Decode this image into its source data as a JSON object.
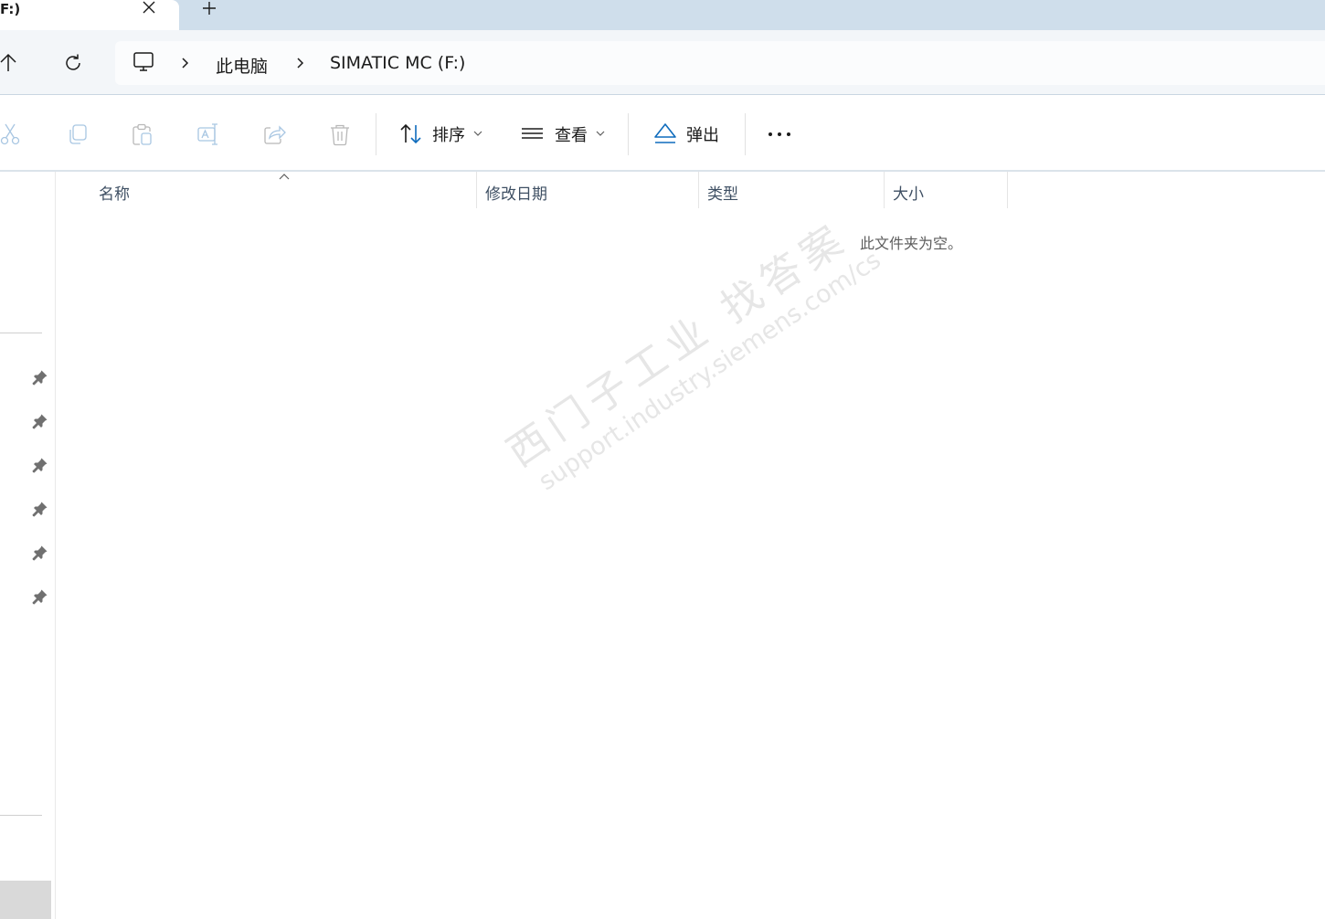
{
  "tab": {
    "title": "F:)",
    "close_icon": "close-icon",
    "new_tab_icon": "plus-icon"
  },
  "nav": {
    "up_icon": "arrow-up-icon",
    "refresh_icon": "refresh-icon"
  },
  "breadcrumb": {
    "root_icon": "monitor-icon",
    "items": [
      {
        "label": "此电脑"
      },
      {
        "label": "SIMATIC MC (F:)"
      }
    ]
  },
  "toolbar": {
    "cut_icon": "cut-icon",
    "copy_icon": "copy-icon",
    "paste_icon": "paste-icon",
    "rename_icon": "rename-icon",
    "share_icon": "share-icon",
    "delete_icon": "delete-icon",
    "sort_label": "排序",
    "view_label": "查看",
    "eject_label": "弹出",
    "more_icon": "more-icon",
    "eject_color": "#0f6cbd"
  },
  "columns": [
    {
      "label": "名称"
    },
    {
      "label": "修改日期"
    },
    {
      "label": "类型"
    },
    {
      "label": "大小"
    }
  ],
  "empty_message": "此文件夹为空。",
  "watermark": {
    "line1": "西门子工业  找答案",
    "line2": "support.industry.siemens.com/cs"
  },
  "sidebar": {
    "pinned_count": 6,
    "pin_icon": "pin-icon"
  }
}
